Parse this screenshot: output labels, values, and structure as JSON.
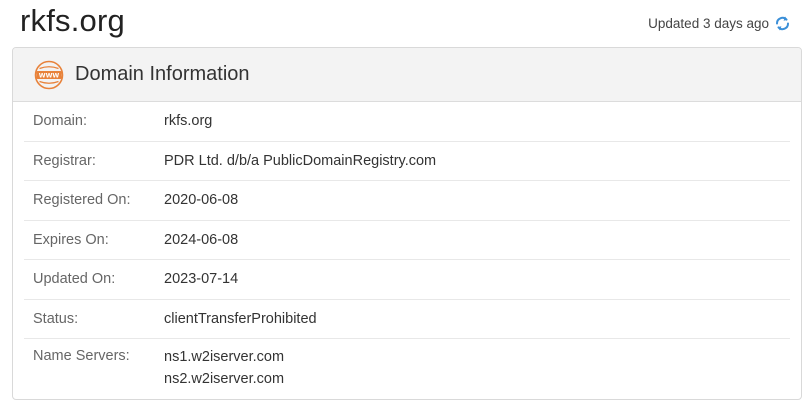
{
  "header": {
    "domain": "rkfs.org",
    "updated_text": "Updated 3 days ago",
    "refresh_icon": "refresh-icon"
  },
  "card": {
    "icon": "www-icon",
    "title": "Domain Information",
    "rows": [
      {
        "label": "Domain:",
        "value": "rkfs.org"
      },
      {
        "label": "Registrar:",
        "value": "PDR Ltd. d/b/a PublicDomainRegistry.com"
      },
      {
        "label": "Registered On:",
        "value": "2020-06-08"
      },
      {
        "label": "Expires On:",
        "value": "2024-06-08"
      },
      {
        "label": "Updated On:",
        "value": "2023-07-14"
      },
      {
        "label": "Status:",
        "value": "clientTransferProhibited"
      }
    ],
    "name_servers": {
      "label": "Name Servers:",
      "values": [
        "ns1.w2iserver.com",
        "ns2.w2iserver.com"
      ]
    }
  },
  "colors": {
    "accent_orange": "#e8823a",
    "refresh_blue": "#3a8fd8"
  }
}
